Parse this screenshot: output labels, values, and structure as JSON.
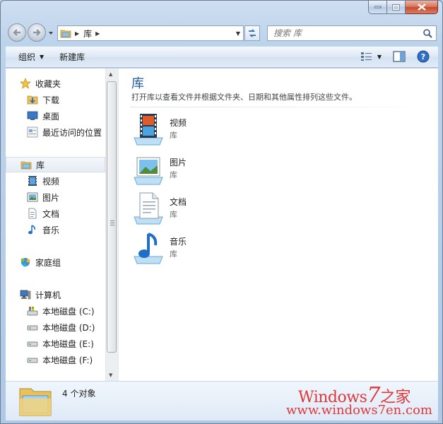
{
  "address": {
    "crumb": "库"
  },
  "search": {
    "placeholder": "搜索 库"
  },
  "toolbar": {
    "organize": "组织",
    "new_library": "新建库"
  },
  "nav": {
    "favorites": "收藏夹",
    "downloads": "下载",
    "desktop": "桌面",
    "recent": "最近访问的位置",
    "libraries": "库",
    "videos": "视频",
    "pictures": "图片",
    "documents": "文档",
    "music": "音乐",
    "homegroup": "家庭组",
    "computer": "计算机",
    "drive_c": "本地磁盘 (C:)",
    "drive_d": "本地磁盘 (D:)",
    "drive_e": "本地磁盘 (E:)",
    "drive_f": "本地磁盘 (F:)"
  },
  "main": {
    "title": "库",
    "description": "打开库以查看文件并根据文件夹、日期和其他属性排列这些文件。",
    "items": [
      {
        "name": "视频",
        "type": "库"
      },
      {
        "name": "图片",
        "type": "库"
      },
      {
        "name": "文档",
        "type": "库"
      },
      {
        "name": "音乐",
        "type": "库"
      }
    ]
  },
  "details": {
    "count": "4 个对象"
  },
  "watermark": {
    "line1a": "Windows",
    "line1b": "7",
    "line1c": "之家",
    "line2": "www.windows7en.com"
  },
  "colors": {
    "accent_title": "#1e5c9e",
    "watermark": "#e0383a"
  }
}
